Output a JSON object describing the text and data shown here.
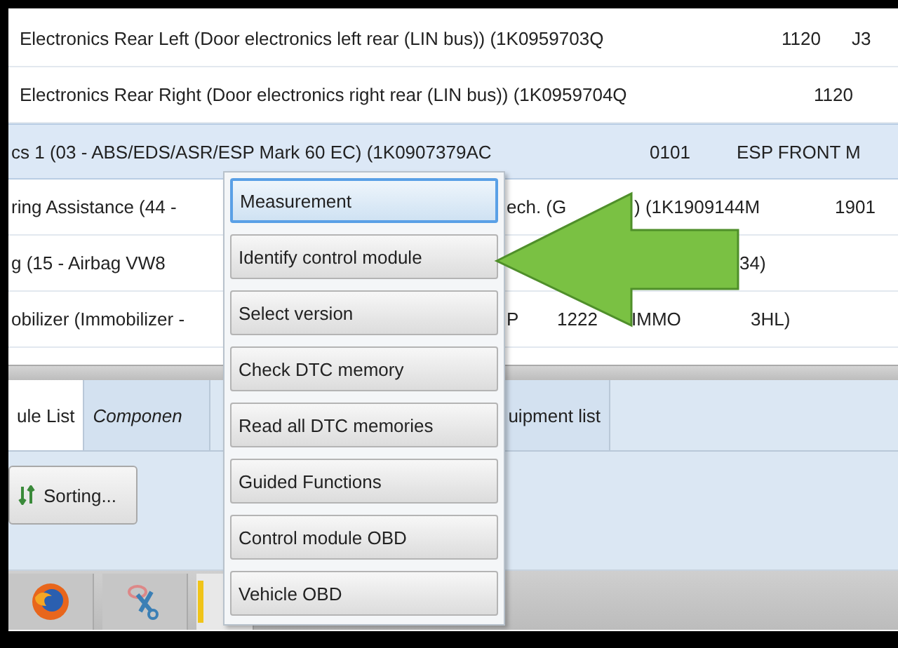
{
  "module_list": {
    "rows": [
      {
        "selected": false,
        "cells": [
          "Electronics Rear Left (Door electronics left rear (LIN bus)) (1K0959703Q",
          "1120",
          "J3"
        ]
      },
      {
        "selected": false,
        "cells": [
          "Electronics Rear Right (Door electronics right rear (LIN bus)) (1K0959704Q",
          "1120"
        ]
      },
      {
        "selected": true,
        "cells": [
          "cs 1 (03 - ABS/EDS/ASR/ESP Mark 60 EC) (1K0907379AC",
          "0101",
          "ESP FRONT M"
        ]
      },
      {
        "selected": false,
        "cells": [
          "ring Assistance (44 -",
          "ech. (G",
          ") (1K1909144M",
          "1901"
        ]
      },
      {
        "selected": false,
        "cells": [
          "g (15 - Airbag VW8",
          "34)"
        ]
      },
      {
        "selected": false,
        "cells": [
          "obilizer (Immobilizer -",
          "P",
          "1222",
          "IMMO",
          "3HL)"
        ]
      }
    ]
  },
  "tabs": [
    {
      "label": "ule List",
      "selected": true
    },
    {
      "label": "Componen",
      "selected": false
    },
    {
      "label": "uipment list",
      "selected": false
    }
  ],
  "sorting_button": "Sorting...",
  "context_menu": [
    {
      "label": "Measurement",
      "selected": true
    },
    {
      "label": "Identify control module",
      "selected": false
    },
    {
      "label": "Select version",
      "selected": false
    },
    {
      "label": "Check DTC memory",
      "selected": false
    },
    {
      "label": "Read all DTC memories",
      "selected": false
    },
    {
      "label": "Guided Functions",
      "selected": false
    },
    {
      "label": "Control module OBD",
      "selected": false
    },
    {
      "label": "Vehicle OBD",
      "selected": false
    }
  ]
}
